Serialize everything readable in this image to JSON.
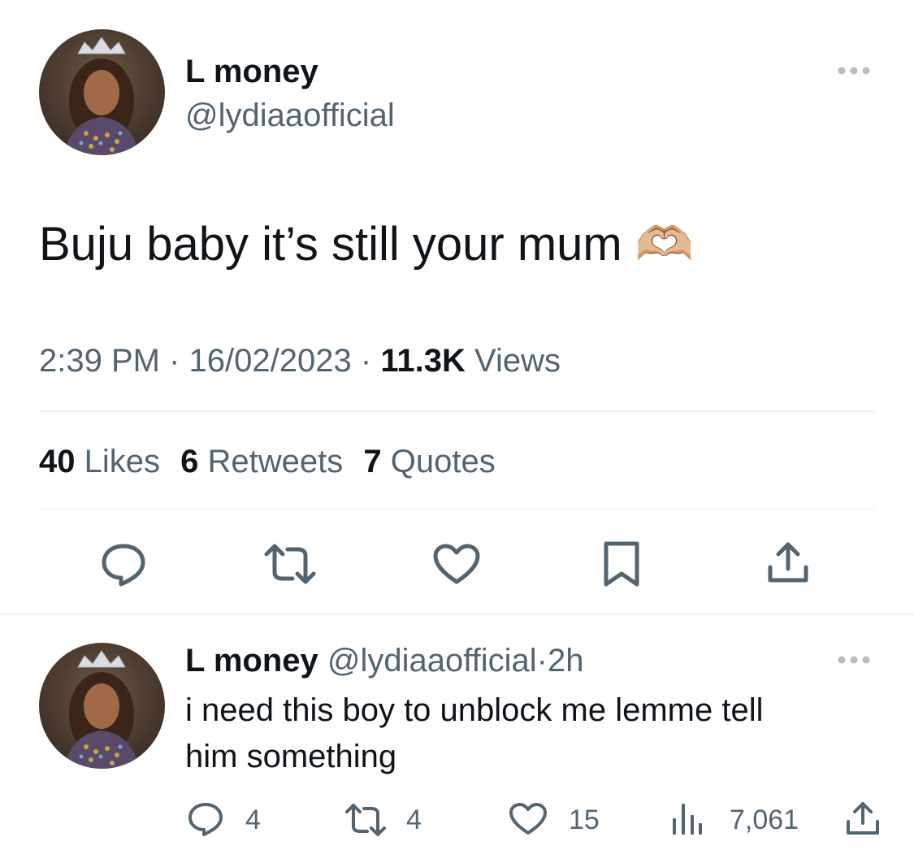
{
  "main_tweet": {
    "author_name": "L money",
    "author_handle": "@lydiaaofficial",
    "text": "Buju baby it’s still your mum 🫶🏼",
    "time": "2:39 PM",
    "separator": "·",
    "date": "16/02/2023",
    "views_count": "11.3K",
    "views_label": "Views",
    "likes_count": "40",
    "likes_label": "Likes",
    "retweets_count": "6",
    "retweets_label": "Retweets",
    "quotes_count": "7",
    "quotes_label": "Quotes"
  },
  "reply": {
    "author_name": "L money",
    "author_handle": "@lydiaaofficial",
    "separator": "·",
    "age": "2h",
    "text_line1": "i need this boy to unblock me lemme tell",
    "text_line2": "him something",
    "reply_count": "4",
    "retweet_count": "4",
    "like_count": "15",
    "view_count": "7,061"
  },
  "icons": {
    "more": "more-horizontal-icon",
    "reply": "reply-icon",
    "retweet": "retweet-icon",
    "like": "heart-icon",
    "bookmark": "bookmark-icon",
    "share": "share-icon",
    "views": "views-chart-icon"
  },
  "colors": {
    "text": "#0f1419",
    "muted": "#536471",
    "divider": "#e6e9ec"
  }
}
